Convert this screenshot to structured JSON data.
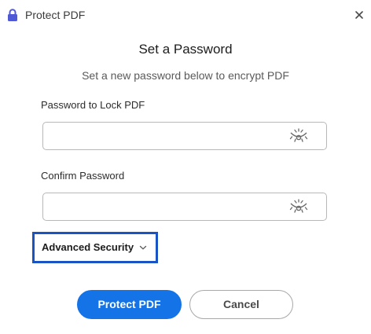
{
  "window": {
    "title": "Protect PDF",
    "title_icon": "lock-icon",
    "close_icon": "close-icon"
  },
  "dialog": {
    "heading": "Set a Password",
    "subheading": "Set a new password below to encrypt PDF"
  },
  "fields": {
    "password": {
      "label": "Password to Lock PDF",
      "value": "",
      "placeholder": "",
      "toggle_icon": "eye-hidden-icon"
    },
    "confirm": {
      "label": "Confirm Password",
      "value": "",
      "placeholder": "",
      "toggle_icon": "eye-hidden-icon"
    }
  },
  "advanced": {
    "label": "Advanced Security",
    "icon": "chevron-down-icon",
    "focus_color": "#1a54c4"
  },
  "buttons": {
    "primary": "Protect PDF",
    "secondary": "Cancel"
  },
  "colors": {
    "accent": "#1473e6",
    "lock_icon": "#4f59d6"
  }
}
